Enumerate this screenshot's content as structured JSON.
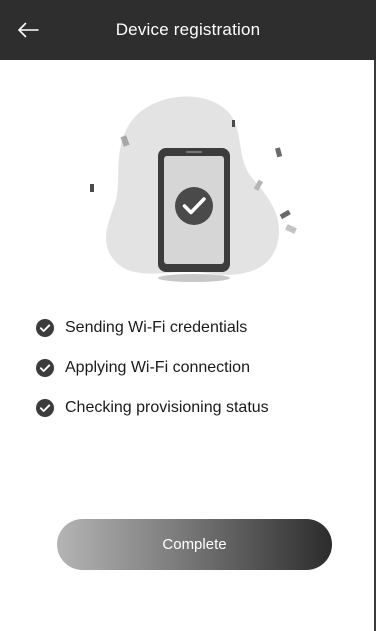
{
  "header": {
    "title": "Device registration",
    "back_icon": "back-arrow-icon"
  },
  "illustration": {
    "icon": "phone-check-illustration"
  },
  "steps": [
    {
      "label": "Sending Wi-Fi credentials",
      "status": "done",
      "icon": "check-circle-icon"
    },
    {
      "label": "Applying Wi-Fi connection",
      "status": "done",
      "icon": "check-circle-icon"
    },
    {
      "label": "Checking provisioning status",
      "status": "done",
      "icon": "check-circle-icon"
    }
  ],
  "actions": {
    "complete_label": "Complete"
  },
  "colors": {
    "header_bg": "#2e2e2e",
    "check": "#3c3c3c",
    "button_start": "#b4b4b4",
    "button_end": "#2c2c2c"
  }
}
